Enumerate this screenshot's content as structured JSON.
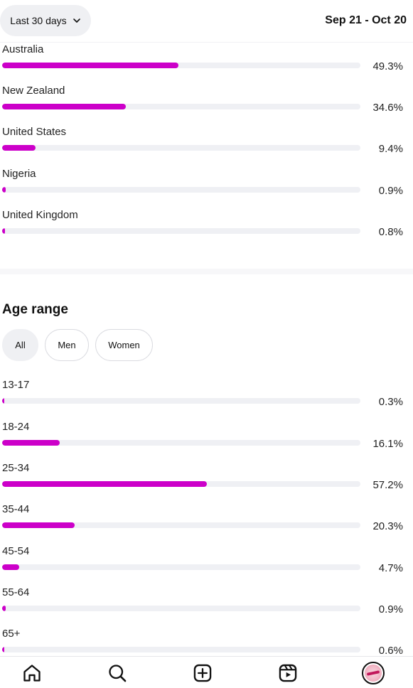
{
  "header": {
    "range_label": "Last 30 days",
    "date_range": "Sep 21 - Oct 20"
  },
  "countries": [
    {
      "name": "Australia",
      "percent": 49.3,
      "label": "49.3%"
    },
    {
      "name": "New Zealand",
      "percent": 34.6,
      "label": "34.6%"
    },
    {
      "name": "United States",
      "percent": 9.4,
      "label": "9.4%"
    },
    {
      "name": "Nigeria",
      "percent": 0.9,
      "label": "0.9%"
    },
    {
      "name": "United Kingdom",
      "percent": 0.8,
      "label": "0.8%"
    }
  ],
  "age": {
    "title": "Age range",
    "filters": [
      {
        "label": "All",
        "active": true
      },
      {
        "label": "Men",
        "active": false
      },
      {
        "label": "Women",
        "active": false
      }
    ],
    "ranges": [
      {
        "name": "13-17",
        "percent": 0.3,
        "label": "0.3%"
      },
      {
        "name": "18-24",
        "percent": 16.1,
        "label": "16.1%"
      },
      {
        "name": "25-34",
        "percent": 57.2,
        "label": "57.2%"
      },
      {
        "name": "35-44",
        "percent": 20.3,
        "label": "20.3%"
      },
      {
        "name": "45-54",
        "percent": 4.7,
        "label": "4.7%"
      },
      {
        "name": "55-64",
        "percent": 0.9,
        "label": "0.9%"
      },
      {
        "name": "65+",
        "percent": 0.6,
        "label": "0.6%"
      }
    ]
  },
  "nav": {
    "items": [
      "home-icon",
      "search-icon",
      "create-icon",
      "reels-icon",
      "profile-avatar"
    ]
  },
  "colors": {
    "accent": "#cc00c9",
    "track": "#eff0f4"
  }
}
